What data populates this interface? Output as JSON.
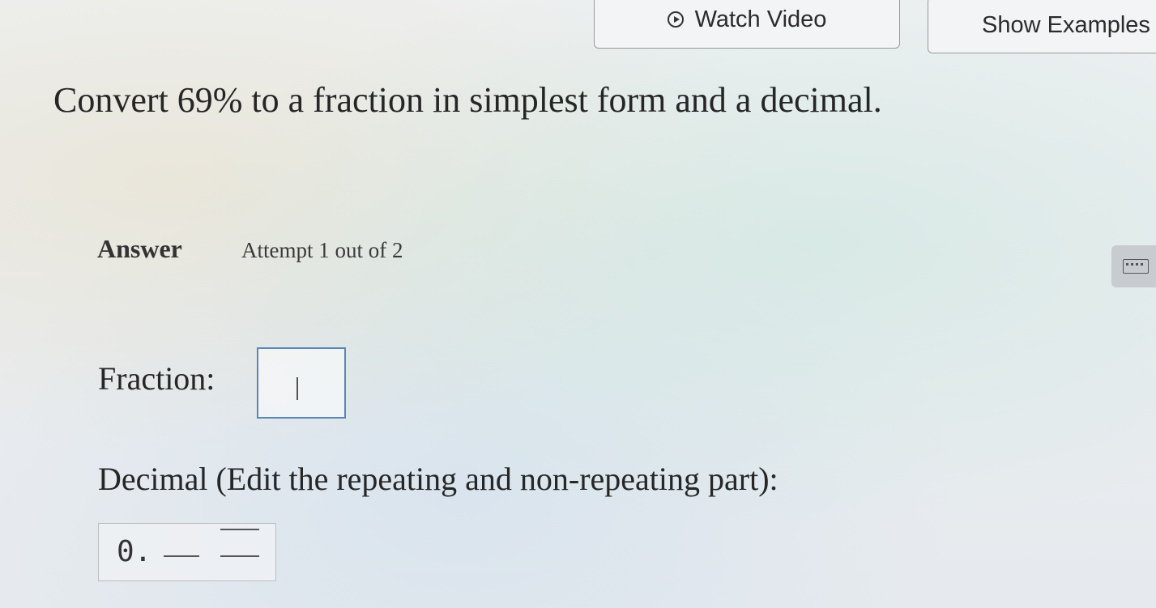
{
  "header": {
    "watch_video_label": "Watch Video",
    "show_examples_label": "Show Examples"
  },
  "question": {
    "text": "Convert 69% to a fraction in simplest form and a decimal."
  },
  "answer": {
    "label": "Answer",
    "attempt": "Attempt 1 out of 2"
  },
  "fraction": {
    "label": "Fraction:",
    "value": ""
  },
  "decimal": {
    "label": "Decimal (Edit the repeating and non-repeating part):",
    "prefix": "0.",
    "nonrepeating_value": "",
    "repeating_value": ""
  },
  "icons": {
    "watch_video": "play-circle-icon",
    "keyboard": "keyboard-icon"
  }
}
